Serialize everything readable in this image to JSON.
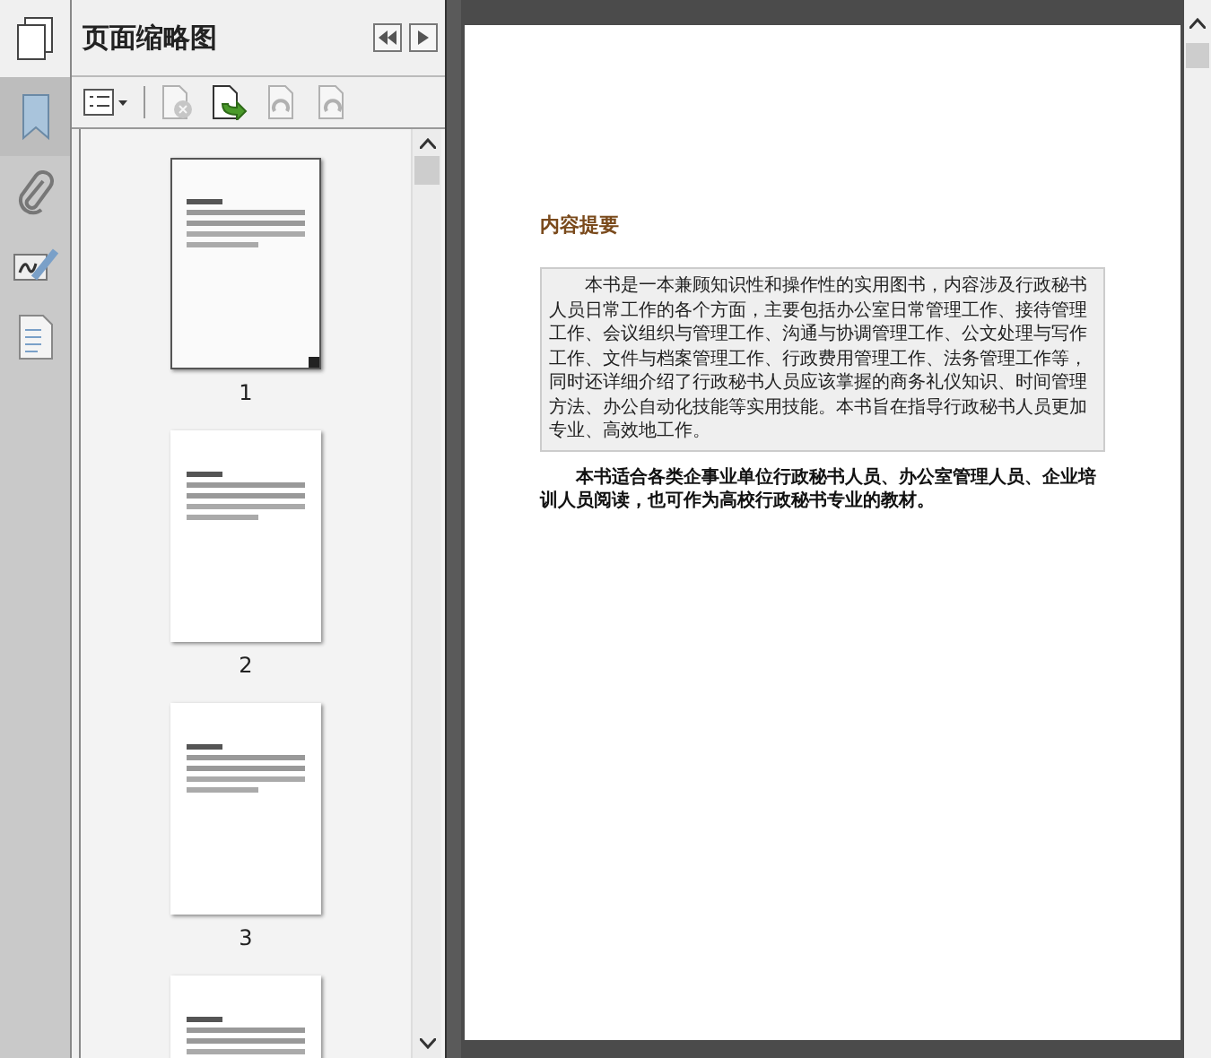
{
  "rail": [
    {
      "kind": "bookmark",
      "selected": true
    },
    {
      "kind": "attachment",
      "selected": false
    },
    {
      "kind": "signature",
      "selected": false
    },
    {
      "kind": "document",
      "selected": false
    }
  ],
  "panel": {
    "title": "页面缩略图"
  },
  "toolbar": [
    {
      "kind": "options",
      "disabled": false
    },
    {
      "kind": "delete",
      "disabled": true
    },
    {
      "kind": "insert",
      "disabled": false
    },
    {
      "kind": "rotate-left",
      "disabled": true
    },
    {
      "kind": "rotate-right",
      "disabled": true
    }
  ],
  "thumbnails": [
    {
      "label": "1",
      "selected": true
    },
    {
      "label": "2",
      "selected": false
    },
    {
      "label": "3",
      "selected": false
    },
    {
      "selected": false
    }
  ],
  "document": {
    "heading": "内容提要",
    "abstract": "本书是一本兼顾知识性和操作性的实用图书，内容涉及行政秘书人员日常工作的各个方面，主要包括办公室日常管理工作、接待管理工作、会议组织与管理工作、沟通与协调管理工作、公文处理与写作工作、文件与档案管理工作、行政费用管理工作、法务管理工作等，同时还详细介绍了行政秘书人员应该掌握的商务礼仪知识、时间管理方法、办公自动化技能等实用技能。本书旨在指导行政秘书人员更加专业、高效地工作。",
    "note": "本书适合各类企事业单位行政秘书人员、办公室管理人员、企业培训人员阅读，也可作为高校行政秘书专业的教材。"
  }
}
